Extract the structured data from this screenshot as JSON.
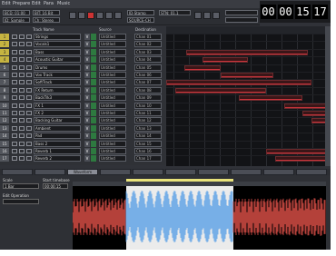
{
  "menu": {
    "items": [
      "Edit",
      "Prepare",
      "Edit",
      "Para",
      "Music"
    ]
  },
  "toolbar": {
    "boxes": [
      "BCD: 01:00",
      "ID: Sample",
      "BIT: 16 Bit",
      "Ch: Stereo",
      "ID-Stamp",
      "SOURCE-CH",
      "STN: 01.1"
    ],
    "buttons": [
      "rewind",
      "stop",
      "play",
      "record",
      "loop",
      "fast-forward"
    ]
  },
  "timecode": {
    "hours": "00",
    "minutes": "00",
    "seconds": "15",
    "frames": "17"
  },
  "track_columns": {
    "name": "Track Name",
    "source": "Source",
    "destination": "Destination"
  },
  "tracks": [
    {
      "num": "1",
      "name": "Strings",
      "v": "V",
      "src": "Untitled",
      "dst": "Chan 01"
    },
    {
      "num": "2",
      "name": "Vocals1",
      "v": "V",
      "src": "Untitled",
      "dst": "Chan 02"
    },
    {
      "num": "3",
      "name": "Bass",
      "v": "V",
      "src": "Untitled",
      "dst": "Chan 03"
    },
    {
      "num": "4",
      "name": "Acoustic Guitar",
      "v": "V",
      "src": "Untitled",
      "dst": "Chan 04"
    },
    {
      "num": "5",
      "name": "Drums",
      "v": "V",
      "src": "Untitled",
      "dst": "Chan 05"
    },
    {
      "num": "6",
      "name": "Vox Track",
      "v": "V",
      "src": "Untitled",
      "dst": "Chan 06"
    },
    {
      "num": "7",
      "name": "SoftTrack",
      "v": "V",
      "src": "Untitled",
      "dst": "Chan 07"
    },
    {
      "num": "8",
      "name": "FX Return",
      "v": "V",
      "src": "Untitled",
      "dst": "Chan 08"
    },
    {
      "num": "9",
      "name": "BackTrk3",
      "v": "V",
      "src": "Untitled",
      "dst": "Chan 09"
    },
    {
      "num": "10",
      "name": "FX 1",
      "v": "V",
      "src": "Untitled",
      "dst": "Chan 10"
    },
    {
      "num": "11",
      "name": "FX 2",
      "v": "V",
      "src": "Untitled",
      "dst": "Chan 11"
    },
    {
      "num": "12",
      "name": "Backing Guitar",
      "v": "V",
      "src": "Untitled",
      "dst": "Chan 12"
    },
    {
      "num": "13",
      "name": "Ambient",
      "v": "V",
      "src": "Untitled",
      "dst": "Chan 13"
    },
    {
      "num": "14",
      "name": "Pad",
      "v": "V",
      "src": "Untitled",
      "dst": "Chan 14"
    },
    {
      "num": "15",
      "name": "Bass 2",
      "v": "V",
      "src": "Untitled",
      "dst": "Chan 15"
    },
    {
      "num": "16",
      "name": "Reverb 1",
      "v": "V",
      "src": "Untitled",
      "dst": "Chan 16"
    },
    {
      "num": "17",
      "name": "Reverb 2",
      "v": "V",
      "src": "Untitled",
      "dst": "Chan 17"
    }
  ],
  "bottom_tabs": [
    "",
    "",
    "Waveform",
    "",
    "",
    "",
    "",
    "",
    "",
    ""
  ],
  "bottom_panel": {
    "label_left1": "Scale",
    "label_left2": "Edit Operation",
    "label_mid": "Start timebase",
    "box1": "1 Bar",
    "box2": "00:00:15"
  },
  "colors": {
    "accent": "#c6b441",
    "waveform_blue": "#5aa0e6",
    "waveform_red": "#e2524a",
    "region": "#3a1618"
  }
}
